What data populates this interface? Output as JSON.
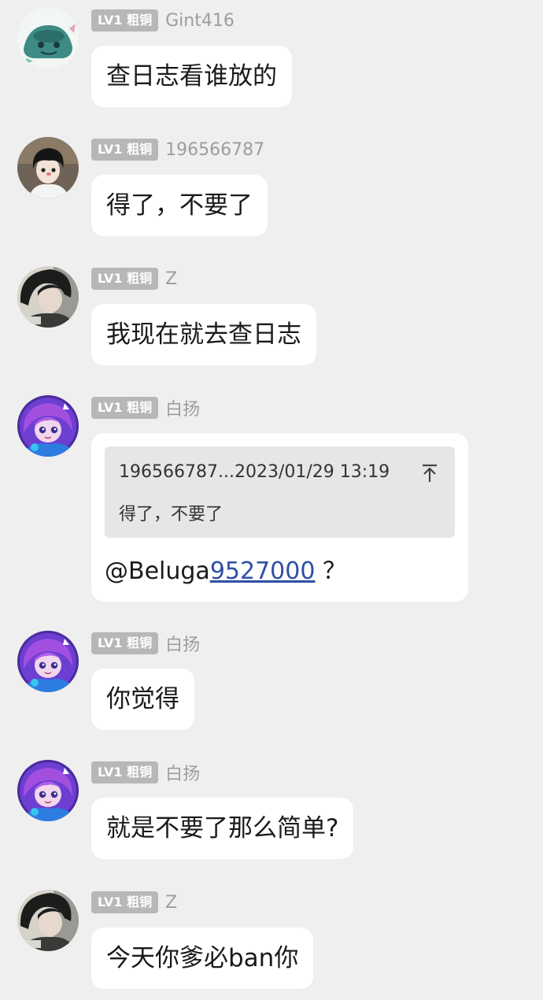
{
  "level_badge": "LV1 粗铜",
  "messages": [
    {
      "username": "Gint416",
      "text": "查日志看谁放的",
      "avatar": "green-creature-avatar"
    },
    {
      "username": "196566787",
      "text": "得了，不要了",
      "avatar": "anime-boy-avatar"
    },
    {
      "username": "Z",
      "text": "我现在就去查日志",
      "avatar": "dark-hair-avatar"
    },
    {
      "username": "白扬",
      "avatar": "purple-anime-avatar",
      "quote": {
        "header": "196566787...2023/01/29 13:19",
        "text": "得了，不要了"
      },
      "mention_prefix": "@Beluga",
      "mention_link": "9527000",
      "mention_suffix": " ？"
    },
    {
      "username": "白扬",
      "text": "你觉得",
      "avatar": "purple-anime-avatar"
    },
    {
      "username": "白扬",
      "text": "就是不要了那么简单?",
      "avatar": "purple-anime-avatar"
    },
    {
      "username": "Z",
      "text": "今天你爹必ban你",
      "avatar": "dark-hair-avatar"
    }
  ],
  "colors": {
    "background": "#efefef",
    "bubble": "#ffffff",
    "badge": "#b7b7b7",
    "link": "#2f4fa6",
    "quote_bg": "#e6e6e6"
  }
}
